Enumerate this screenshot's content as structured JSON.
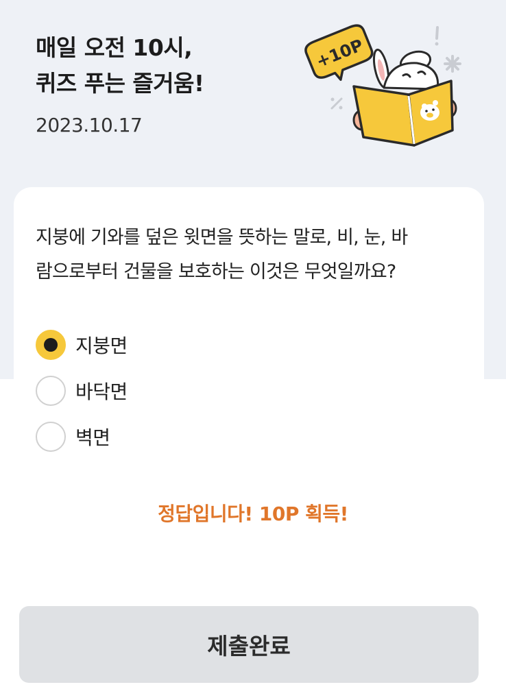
{
  "header": {
    "title_line1": "매일 오전 10시,",
    "title_line2": "퀴즈 푸는 즐거움!",
    "date": "2023.10.17",
    "badge": "+10P",
    "illustration_icon": "rabbit-reading-book-icon"
  },
  "quiz": {
    "question_line1": "지붕에 기와를 덮은 윗면을 뜻하는 말로, 비, 눈, 바",
    "question_line2": "람으로부터 건물을 보호하는 이것은 무엇일까요?",
    "options": [
      {
        "label": "지붕면",
        "selected": true
      },
      {
        "label": "바닥면",
        "selected": false
      },
      {
        "label": "벽면",
        "selected": false
      }
    ],
    "result": "정답입니다! 10P 획득!"
  },
  "submit": {
    "label": "제출완료"
  },
  "colors": {
    "header_bg": "#eef1f6",
    "accent_yellow": "#f6c83b",
    "result_orange": "#e0762a",
    "button_bg": "#dfe1e4"
  }
}
